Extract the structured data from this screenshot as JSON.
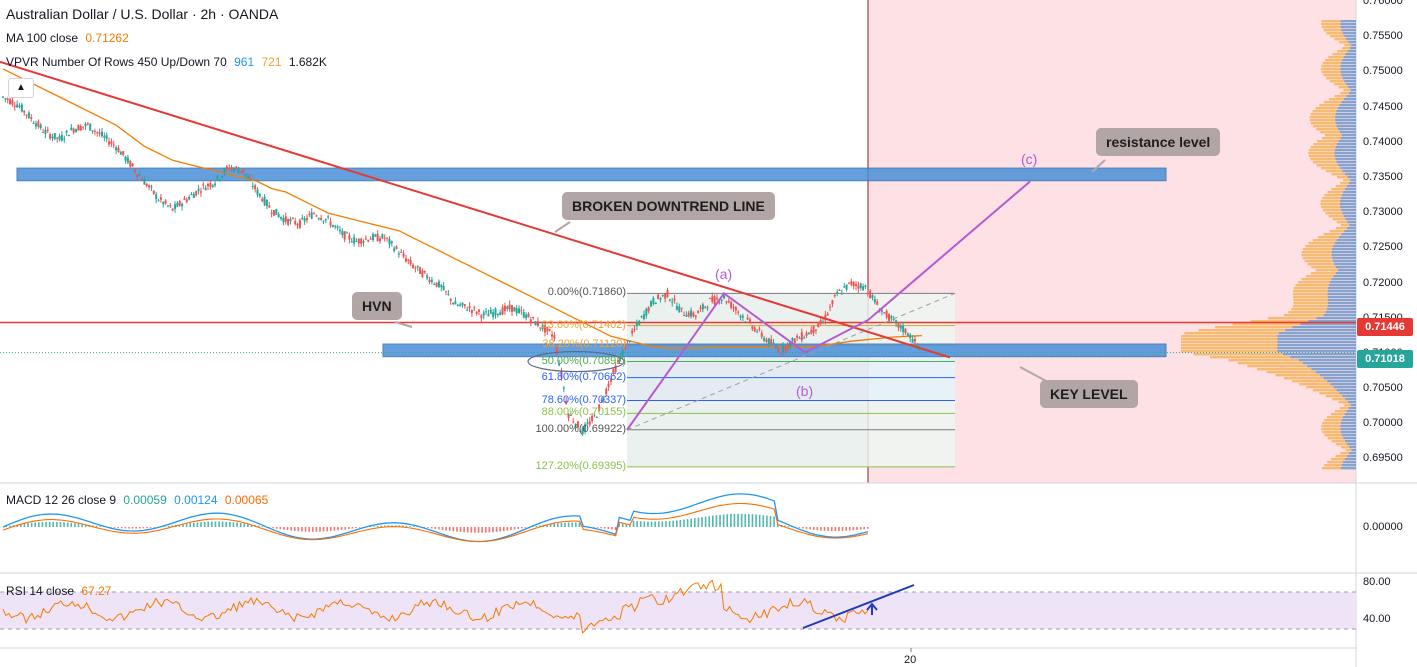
{
  "header": {
    "symbol_line": "Australian Dollar / U.S. Dollar · 2h · OANDA",
    "ma_label": "MA 100 close",
    "ma_value": "0.71262",
    "vpvr_label": "VPVR Number Of Rows 450 Up/Down 70",
    "vpvr_v1": "961",
    "vpvr_v2": "721",
    "vpvr_v3": "1.682K"
  },
  "price_axis": [
    "0.76000",
    "0.75500",
    "0.75000",
    "0.74500",
    "0.74000",
    "0.73500",
    "0.73000",
    "0.72500",
    "0.72000",
    "0.71500",
    "0.71000",
    "0.70500",
    "0.70000",
    "0.69500"
  ],
  "price_tags": {
    "upper": "0.71446",
    "lower": "0.71018"
  },
  "annotations": {
    "broken_downtrend": "BROKEN DOWNTREND LINE",
    "hvn": "HVN",
    "resistance": "resistance level",
    "key_level": "KEY LEVEL",
    "wave_a": "(a)",
    "wave_b": "(b)",
    "wave_c": "(c)"
  },
  "fib_levels": [
    {
      "label": "0.00%(0.71860)",
      "color": "#787b86"
    },
    {
      "label": "23.60%(0.71402)",
      "color": "#f2a02d"
    },
    {
      "label": "38.20%(0.71120)",
      "color": "#f2a02d"
    },
    {
      "label": "50.00%(0.70891)",
      "color": "#4caf50"
    },
    {
      "label": "61.80%(0.70662)",
      "color": "#2962ff"
    },
    {
      "label": "78.60%(0.70337)",
      "color": "#2962ff"
    },
    {
      "label": "88.00%(0.70155)",
      "color": "#8bc34a"
    },
    {
      "label": "100.00%(0.69922)",
      "color": "#787b86"
    },
    {
      "label": "127.20%(0.69395)",
      "color": "#8bc34a"
    }
  ],
  "macd": {
    "label": "MACD 12 26 close 9",
    "v1": "0.00059",
    "v2": "0.00124",
    "v3": "0.00065",
    "axis": "0.00000"
  },
  "rsi": {
    "label": "RSI 14 close",
    "value": "67.27",
    "axis_top": "80.00",
    "axis_bottom": "40.00"
  },
  "time_axis": {
    "label": "20"
  },
  "colors": {
    "up": "#26a69a",
    "down": "#ef5350",
    "ma": "#f57c00",
    "trend": "#e53935",
    "zone": "#4a90d9",
    "macd": "#2196f3",
    "signal": "#ff6d00",
    "rsi": "#f57c00",
    "wave": "#b55bd1"
  },
  "chart_data": {
    "type": "line",
    "title": "Australian Dollar / U.S. Dollar · 2h · OANDA",
    "ylim": [
      0.6935,
      0.76
    ],
    "series": [
      {
        "name": "AUDUSD",
        "values": [
          0.7465,
          0.7455,
          0.7435,
          0.7415,
          0.7405,
          0.742,
          0.7425,
          0.741,
          0.7395,
          0.737,
          0.7345,
          0.732,
          0.7305,
          0.732,
          0.7335,
          0.7345,
          0.7365,
          0.736,
          0.733,
          0.7305,
          0.729,
          0.7285,
          0.73,
          0.729,
          0.727,
          0.726,
          0.7265,
          0.7265,
          0.7245,
          0.7225,
          0.721,
          0.7195,
          0.717,
          0.7165,
          0.7155,
          0.716,
          0.7165,
          0.7155,
          0.714,
          0.7125,
          0.7015,
          0.699,
          0.7015,
          0.7065,
          0.711,
          0.7145,
          0.7175,
          0.7185,
          0.716,
          0.7155,
          0.7175,
          0.718,
          0.716,
          0.714,
          0.712,
          0.7105,
          0.712,
          0.713,
          0.7145,
          0.7185,
          0.72,
          0.7195,
          0.7165,
          0.7145,
          0.713,
          0.7102
        ]
      },
      {
        "name": "MA 100 close",
        "values": [
          0.7505,
          0.7495,
          0.7485,
          0.7475,
          0.7465,
          0.7455,
          0.7445,
          0.7435,
          0.7425,
          0.741,
          0.7395,
          0.7385,
          0.7375,
          0.737,
          0.7365,
          0.736,
          0.7355,
          0.735,
          0.7345,
          0.7335,
          0.733,
          0.732,
          0.731,
          0.73,
          0.7295,
          0.729,
          0.7285,
          0.728,
          0.7275,
          0.7265,
          0.7255,
          0.7245,
          0.7235,
          0.7225,
          0.7215,
          0.7205,
          0.7195,
          0.7185,
          0.7175,
          0.7165,
          0.7155,
          0.7145,
          0.7135,
          0.7125,
          0.712,
          0.7115,
          0.711,
          0.7108,
          0.7108,
          0.7108,
          0.7109,
          0.711,
          0.711,
          0.711,
          0.711,
          0.7109,
          0.7109,
          0.711,
          0.7112,
          0.7115,
          0.7118,
          0.712,
          0.7122,
          0.7124,
          0.7125,
          0.7126
        ]
      }
    ],
    "levels": {
      "current": 0.71018,
      "horizontal_line": 0.71446,
      "resistance_zone": [
        0.7346,
        0.7364
      ],
      "key_zone": [
        0.7096,
        0.7114
      ]
    }
  }
}
